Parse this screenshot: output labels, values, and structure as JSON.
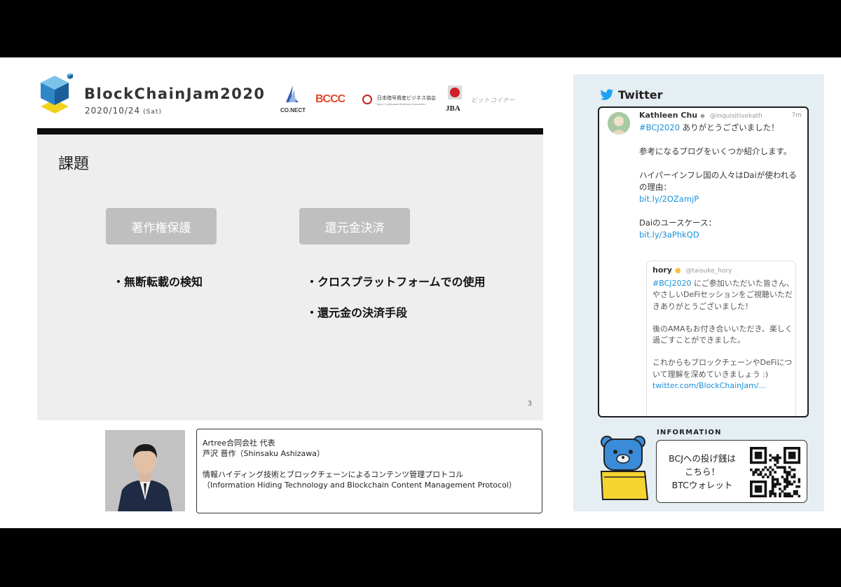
{
  "header": {
    "event_title": "BlockChainJam2020",
    "event_date": "2020/10/24",
    "event_day": "(Sat)",
    "sponsors": [
      "CO.NECT",
      "BCCC",
      "日本暗号資産ビジネス協会",
      "Japan Cryptoasset Business Association",
      "JBA",
      "ビットコイナー"
    ]
  },
  "slide": {
    "title": "課題",
    "categories": [
      "著作権保護",
      "還元金決済"
    ],
    "bullets_left": [
      "・無断転載の検知"
    ],
    "bullets_right": [
      "・クロスプラットフォームでの使用",
      "・還元金の決済手段"
    ],
    "page_number": "3"
  },
  "speaker": {
    "org": "Artree合同会社 代表",
    "name": "芦沢 晋作（Shinsaku Ashizawa）",
    "talk_ja": "情報ハイディング技術とブロックチェーンによるコンテンツ管理プロトコル",
    "talk_en": "（Information Hiding Technology and Blockchain Content Management Protocol）"
  },
  "twitter": {
    "header": "Twitter",
    "tweet": {
      "name": "Kathleen Chu",
      "handle": "@inquisitivekath",
      "time": "7m",
      "hashtag": "#BCJ2020",
      "line1": " ありがとうございました！",
      "para2": "参考になるブログをいくつか紹介します。",
      "para3": "ハイパーインフレ国の人々はDaiが使われるの理由：",
      "link1": "bit.ly/2OZamjP",
      "para4": "Daiのユースケース：",
      "link2": "bit.ly/3aPhkQD"
    },
    "quote": {
      "name": "hory",
      "handle": "@taisuke_hory",
      "hashtag": "#BCJ2020",
      "text1": " にご参加いただいた皆さん、やさしいDeFiセッションをご視聴いただきありがとうございました！",
      "text2": "後のAMAもお付き合いいただき、楽しく過ごすことができました。",
      "text3": "これからもブロックチェーンやDeFiについて理解を深めていきましょう :)",
      "link": "twitter.com/BlockChainJam/..."
    }
  },
  "information": {
    "label": "INFORMATION",
    "line1": "BCJへの投げ銭は",
    "line2": "こちら！",
    "line3": "BTCウォレット"
  },
  "colors": {
    "twitter_blue": "#1da1f2",
    "slide_bg": "#eeeeee",
    "panel_bg": "#e5eef2",
    "category_box": "#bfbfbf"
  }
}
